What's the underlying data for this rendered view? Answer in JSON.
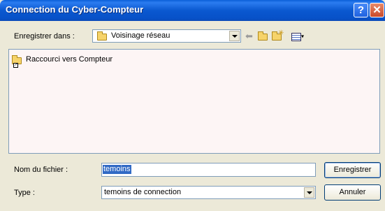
{
  "window": {
    "title": "Connection du Cyber-Compteur"
  },
  "titlebar": {
    "help_glyph": "?",
    "close_glyph": "✕"
  },
  "toolbar": {
    "save_in_label": "Enregistrer dans :",
    "save_in_value": "Voisinage réseau",
    "icons": [
      "back-arrow-icon",
      "up-folder-icon",
      "new-folder-icon",
      "view-menu-icon"
    ]
  },
  "file_list": {
    "items": [
      {
        "label": "Raccourci vers Compteur",
        "icon": "shortcut-folder-icon"
      }
    ]
  },
  "form": {
    "filename_label": "Nom du fichier :",
    "filename_value": "temoins",
    "type_label": "Type :",
    "type_value": "temoins de connection"
  },
  "buttons": {
    "save": "Enregistrer",
    "cancel": "Annuler"
  },
  "colors": {
    "titlebar": "#0a58d0",
    "dialog_bg": "#ece9d8",
    "selection": "#316ac5"
  }
}
